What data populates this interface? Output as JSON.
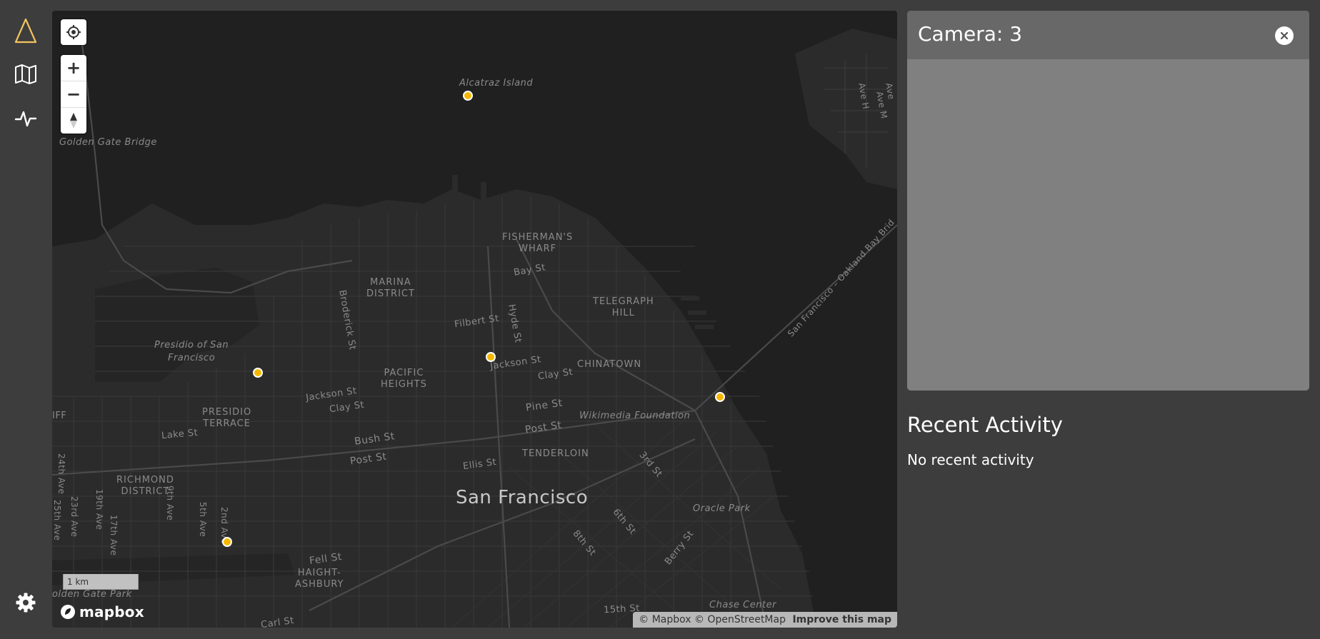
{
  "nav": {
    "items": [
      {
        "name": "logo-icon"
      },
      {
        "name": "map-icon"
      },
      {
        "name": "activity-icon"
      },
      {
        "name": "settings-icon"
      }
    ],
    "brand_color": "#f3c35f"
  },
  "map": {
    "controls": {
      "locate": "locate-icon",
      "zoom_in": "+",
      "zoom_out": "−",
      "compass": "compass-icon"
    },
    "labels": {
      "alcatraz": "Alcatraz Island",
      "golden_gate_bridge": "Golden Gate Bridge",
      "fishermans_wharf_1": "FISHERMAN'S",
      "fishermans_wharf_2": "WHARF",
      "marina_1": "MARINA",
      "marina_2": "DISTRICT",
      "telegraph_1": "TELEGRAPH",
      "telegraph_2": "HILL",
      "presidio_sf_1": "Presidio of San",
      "presidio_sf_2": "Francisco",
      "pacific_1": "PACIFIC",
      "pacific_2": "HEIGHTS",
      "chinatown": "CHINATOWN",
      "presidio_terrace_1": "PRESIDIO",
      "presidio_terrace_2": "TERRACE",
      "wikimedia": "Wikimedia Foundation",
      "tenderloin": "TENDERLOIN",
      "richmond_1": "RICHMOND",
      "richmond_2": "DISTRICT",
      "city": "San Francisco",
      "oracle_park": "Oracle Park",
      "haight_1": "HAIGHT-",
      "haight_2": "ASHBURY",
      "golden_gate_park": "olden Gate Park",
      "chase_center": "Chase Center",
      "bay_bridge": "San Francisco – Oakland Bay Brid",
      "iff": "IFF",
      "bay_st": "Bay St",
      "hyde_st": "Hyde St",
      "broderick_st": "Broderick St",
      "filbert_st": "Filbert St",
      "jackson_st_1": "Jackson St",
      "jackson_st_2": "Jackson St",
      "clay_st_1": "Clay St",
      "clay_st_2": "Clay St",
      "pine_st": "Pine St",
      "post_st_1": "Post St",
      "post_st_2": "Post St",
      "bush_st": "Bush St",
      "lake_st": "Lake St",
      "ellis_st": "Ellis St",
      "third_st": "3rd St",
      "sixth_st": "6th St",
      "eighth_st": "8th St",
      "berry_st": "Berry St",
      "fell_st": "Fell St",
      "carl_st": "Carl St",
      "fifteenth_st": "15th St",
      "ave_24": "24th Ave",
      "ave_25": "25th Ave",
      "ave_23": "23rd Ave",
      "ave_19": "19th Ave",
      "ave_17": "17th Ave",
      "ave_9": "9th Ave",
      "ave_5": "5th Ave",
      "ave_2": "2nd Ave",
      "ave_h": "Ave H",
      "ave_m": "Ave M",
      "ave_n": "Ave"
    },
    "marker_color": "#f5b800",
    "scale": "1 km",
    "logo": "mapbox",
    "attribution": {
      "mapbox": "© Mapbox",
      "osm": "© OpenStreetMap",
      "improve": "Improve this map"
    }
  },
  "camera_panel": {
    "title": "Camera: 3",
    "close": "close-icon"
  },
  "recent_activity": {
    "title": "Recent Activity",
    "empty": "No recent activity"
  }
}
